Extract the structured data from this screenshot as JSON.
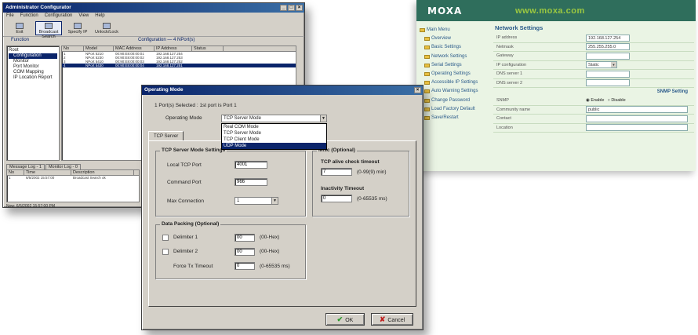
{
  "back_window": {
    "title": "Administrator Configurator",
    "menu": [
      "File",
      "Function",
      "Configuration",
      "View",
      "Help"
    ],
    "toolbar": [
      "Exit",
      "Broadcast Search",
      "Specify IP",
      "Unlock/Lock"
    ],
    "pane_left_title": "Function",
    "pane_right_title": "Configuration — 4 NPort(s)",
    "tree": [
      "Root",
      "Configuration",
      "Monitor",
      "Port Monitor",
      "COM Mapping",
      "IP Location Report"
    ],
    "columns": [
      "No",
      "Model",
      "MAC Address",
      "IP Address",
      "Status"
    ],
    "rows": [
      [
        "1",
        "NPort 5210",
        "00:90:E8:00:00:01",
        "192.168.127.254",
        ""
      ],
      [
        "2",
        "NPort 5230",
        "00:90:E8:00:00:02",
        "192.168.127.253",
        ""
      ],
      [
        "3",
        "NPort 5410",
        "00:90:E8:00:00:03",
        "192.168.127.252",
        ""
      ],
      [
        "4",
        "NPort 5430",
        "00:90:E8:00:00:04",
        "192.168.127.251",
        ""
      ]
    ],
    "bottom_tabs": [
      "Message Log - 1",
      "Monitor Log - 0"
    ],
    "log_columns": [
      "No",
      "Time",
      "Description"
    ],
    "log_row": [
      "1",
      "6/5/2002 15:57:00",
      "Broadcast Search ok"
    ],
    "status": "Now: 6/5/2002 15:57:00 PM"
  },
  "dialog": {
    "title": "Operating Mode",
    "ports_selected": "1 Port(s) Selected : 1st port is Port 1",
    "mode_label": "Operating Mode",
    "mode_value": "TCP Server Mode",
    "dropdown": [
      "Real COM Mode",
      "TCP Server Mode",
      "TCP Client Mode",
      "UDP Mode"
    ],
    "dropdown_highlight": 3,
    "tab": "TCP Server",
    "settings_group": "TCP Server Mode Settings",
    "local_port_label": "Local TCP Port",
    "local_port": "4001",
    "command_port_label": "Command Port",
    "command_port": "966",
    "max_conn_label": "Max Connection",
    "max_conn": "1",
    "misc_group": "Misc (Optional)",
    "alive_label": "TCP alive check timeout",
    "alive_value": "7",
    "alive_range": "(0-99(9) min)",
    "inactivity_label": "Inactivity Timeout",
    "inactivity_value": "0",
    "inactivity_range": "(0-65535 ms)",
    "packing_group": "Data Packing (Optional)",
    "delim1_label": "Delimiter 1",
    "delim1": "00",
    "delim2_label": "Delimiter 2",
    "delim2": "00",
    "hex_unit": "(00-Hex)",
    "force_label": "Force Tx Timeout",
    "force_value": "0",
    "force_unit": "(0-65535 ms)",
    "ok": "OK",
    "cancel": "Cancel"
  },
  "web": {
    "logo": "MOXA",
    "url": "www.moxa.com",
    "title": "Network Settings",
    "nav": [
      "Main Menu",
      "Overview",
      "Basic Settings",
      "Network Settings",
      "Serial Settings",
      "Operating Settings",
      "Accessible IP Settings",
      "Auto Warning Settings",
      "Change Password",
      "Load Factory Default",
      "Save/Restart"
    ],
    "fields": [
      {
        "label": "IP address",
        "value": "192.168.127.254"
      },
      {
        "label": "Netmask",
        "value": "255.255.255.0"
      },
      {
        "label": "Gateway",
        "value": ""
      },
      {
        "label": "IP configuration",
        "value": "Static"
      },
      {
        "label": "DNS server 1",
        "value": ""
      },
      {
        "label": "DNS server 2",
        "value": ""
      }
    ],
    "snmp_section": "SNMP Setting",
    "snmp": {
      "label": "SNMP",
      "enable": "Enable",
      "disable": "Disable"
    },
    "snmp_fields": [
      {
        "label": "Community name",
        "value": "public"
      },
      {
        "label": "Contact",
        "value": ""
      },
      {
        "label": "Location",
        "value": ""
      }
    ]
  }
}
